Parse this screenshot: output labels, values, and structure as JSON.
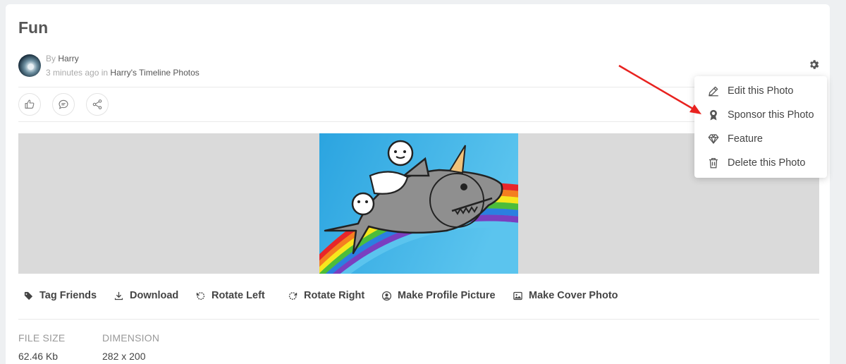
{
  "post": {
    "title": "Fun",
    "by_label": "By",
    "author": "Harry",
    "time": "3 minutes ago",
    "in_label": "in",
    "album": "Harry's Timeline Photos"
  },
  "menu": {
    "items": [
      {
        "label": "Edit this Photo",
        "icon": "edit-icon"
      },
      {
        "label": "Sponsor this Photo",
        "icon": "sponsor-icon"
      },
      {
        "label": "Feature",
        "icon": "diamond-icon"
      },
      {
        "label": "Delete this Photo",
        "icon": "trash-icon"
      }
    ]
  },
  "actions": {
    "tag_friends": "Tag Friends",
    "download": "Download",
    "rotate_left": "Rotate Left",
    "rotate_right": "Rotate Right",
    "make_profile_picture": "Make Profile Picture",
    "make_cover_photo": "Make Cover Photo"
  },
  "info": {
    "file_size_label": "FILE SIZE",
    "file_size_value": "62.46 Kb",
    "dimension_label": "DIMENSION",
    "dimension_value": "282 x 200"
  },
  "colors": {
    "annotation_arrow": "#e8221f"
  }
}
